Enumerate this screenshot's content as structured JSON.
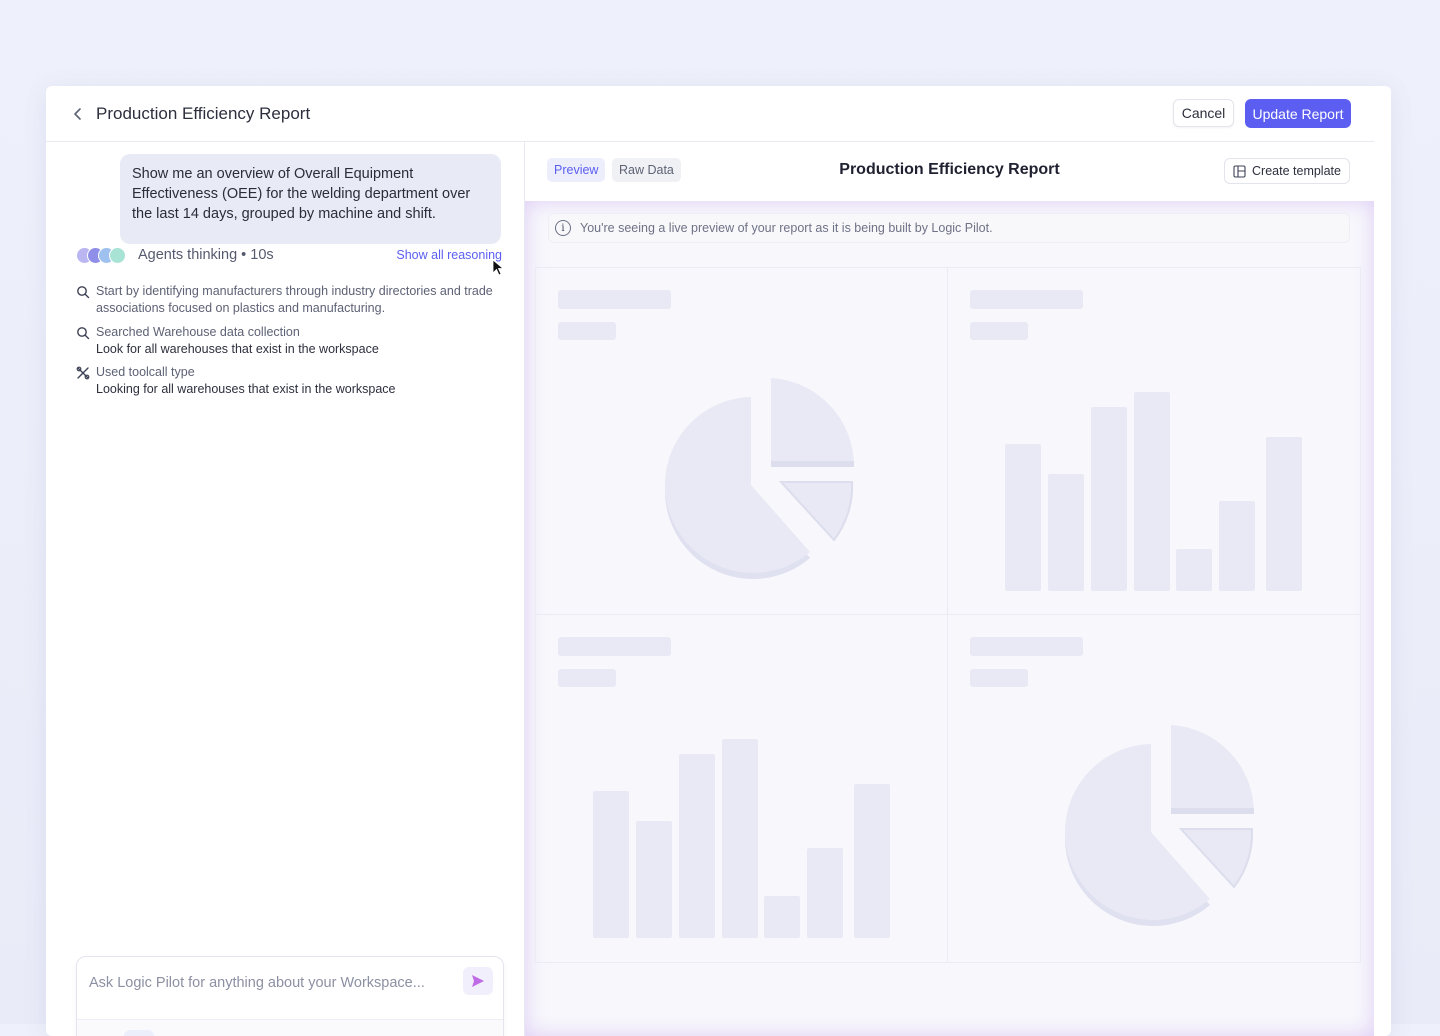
{
  "header": {
    "title": "Production Efficiency Report",
    "cancel_label": "Cancel",
    "update_label": "Update Report"
  },
  "chat": {
    "user_message": "Show me an overview of Overall Equipment Effectiveness (OEE) for the welding department over the last 14 days, grouped by machine and shift.",
    "thinking_label": "Agents thinking • 10s",
    "show_reasoning_label": "Show all reasoning",
    "steps": [
      {
        "icon": "search-icon",
        "title": "Start by identifying manufacturers through industry directories and trade associations focused on plastics and manufacturing.",
        "subtitle": ""
      },
      {
        "icon": "search-icon",
        "title": "Searched Warehouse data collection",
        "subtitle": "Look for all warehouses that exist in the workspace"
      },
      {
        "icon": "tools-icon",
        "title": "Used toolcall type",
        "subtitle": "Looking for all warehouses that exist in the workspace"
      }
    ],
    "composer": {
      "placeholder": "Ask Logic Pilot for anything about your Workspace..."
    }
  },
  "preview": {
    "tabs": [
      {
        "label": "Preview",
        "active": true
      },
      {
        "label": "Raw Data",
        "active": false
      }
    ],
    "report_title": "Production Efficiency Report",
    "create_template_label": "Create template",
    "info_text": "You're seeing a live preview of your report as it is being built by Logic Pilot.",
    "placeholder_charts": [
      "pie",
      "bar",
      "bar",
      "pie"
    ]
  },
  "colors": {
    "accent": "#5b5ef0",
    "skeleton": "#e8e9f4",
    "user_bubble": "#e8eaf6"
  }
}
